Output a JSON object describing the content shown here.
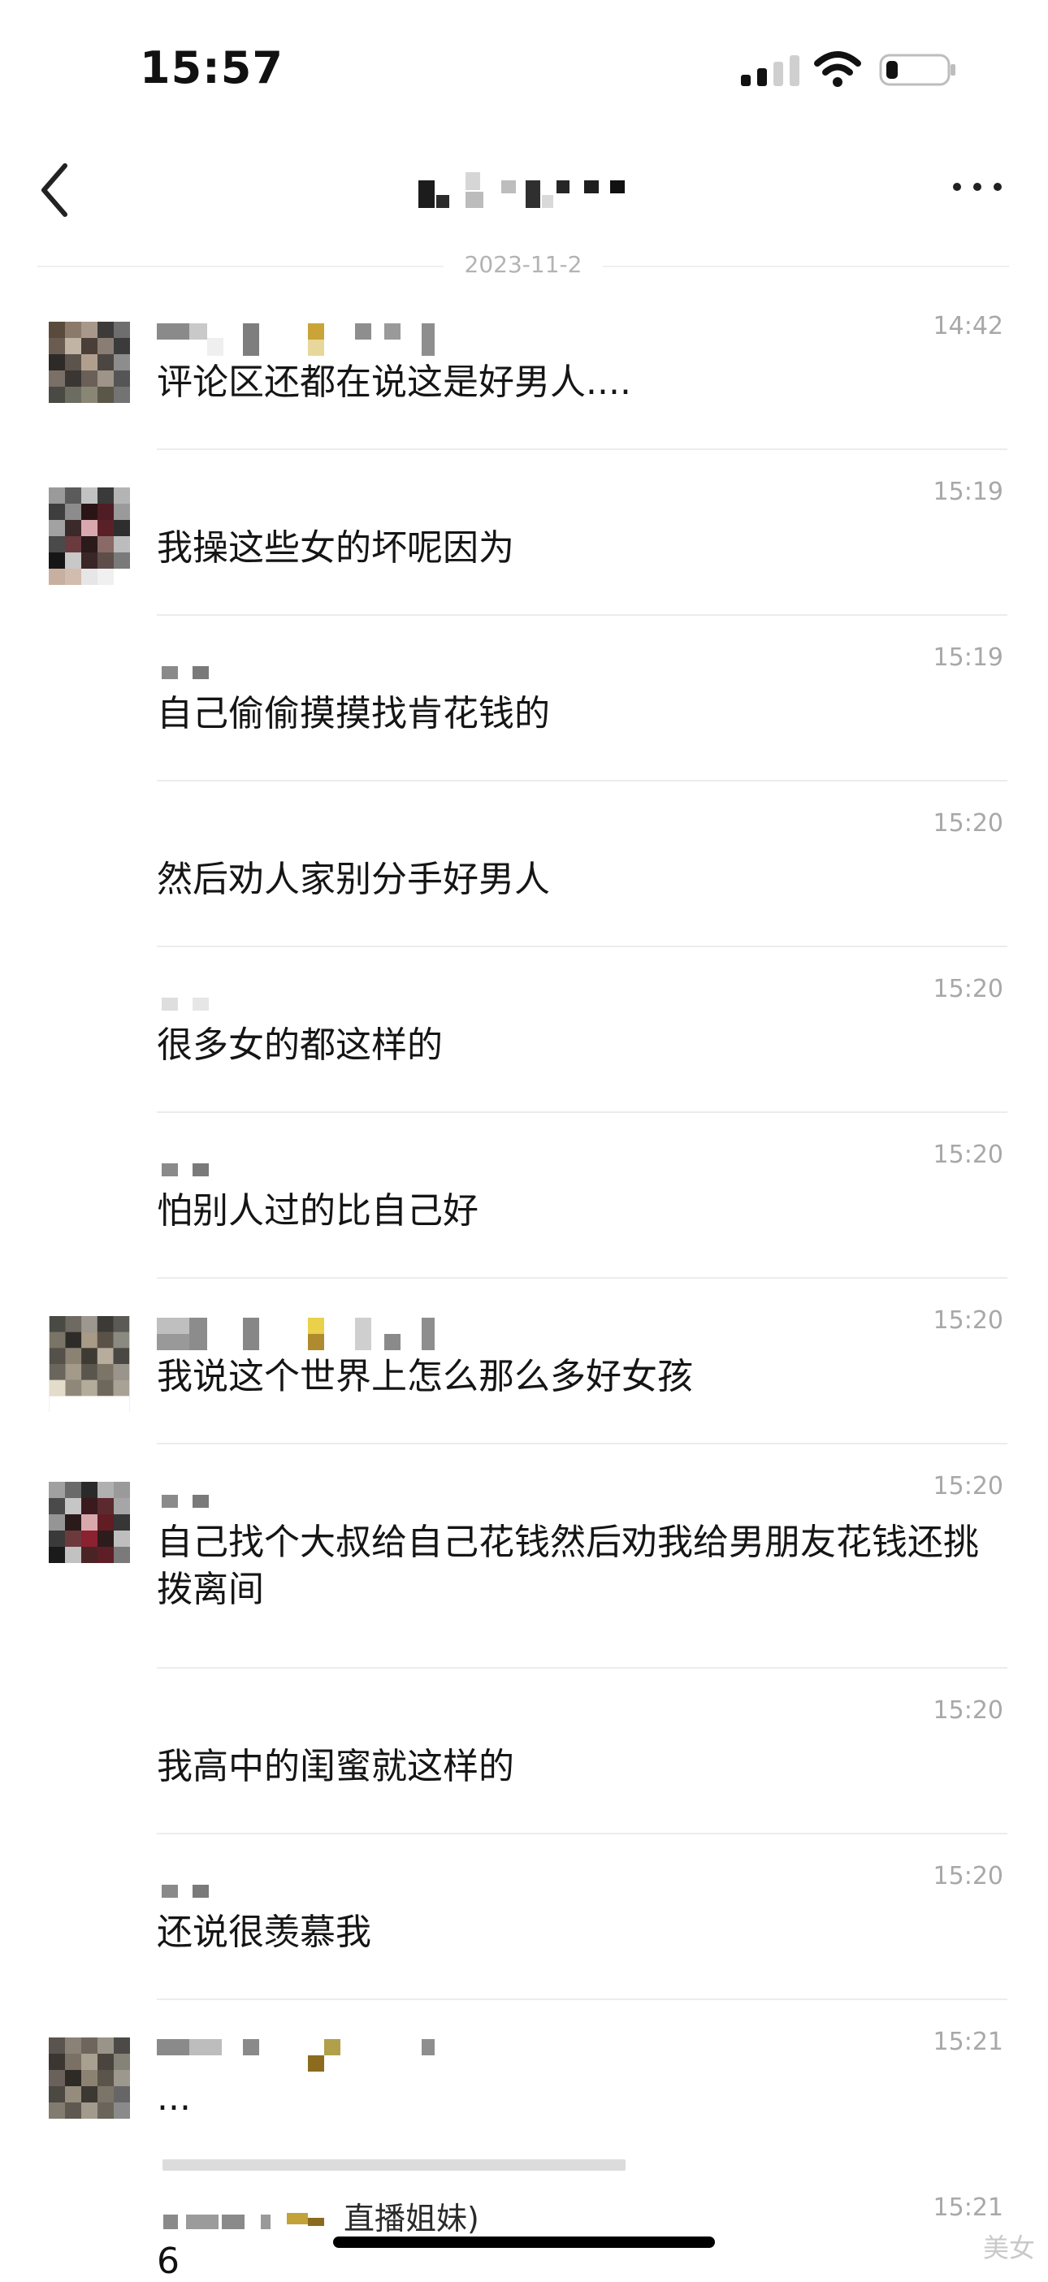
{
  "status_bar": {
    "time": "15:57"
  },
  "header": {
    "back_icon": "chevron-left-icon",
    "more_icon": "ellipsis-icon"
  },
  "date_divider": "2023-11-2",
  "messages": [
    {
      "time": "14:42",
      "text": "评论区还都在说这是好男人....",
      "avatar": true
    },
    {
      "time": "15:19",
      "text": "我操这些女的坏呢因为",
      "avatar": true
    },
    {
      "time": "15:19",
      "text": "自己偷偷摸摸找肯花钱的",
      "avatar": false
    },
    {
      "time": "15:20",
      "text": "然后劝人家别分手好男人",
      "avatar": false
    },
    {
      "time": "15:20",
      "text": "很多女的都这样的",
      "avatar": false
    },
    {
      "time": "15:20",
      "text": "怕别人过的比自己好",
      "avatar": false
    },
    {
      "time": "15:20",
      "text": "我说这个世界上怎么那么多好女孩",
      "avatar": true
    },
    {
      "time": "15:20",
      "text": "自己找个大叔给自己花钱然后劝我给男朋友花钱还挑拨离间",
      "avatar": true
    },
    {
      "time": "15:20",
      "text": "我高中的闺蜜就这样的",
      "avatar": false
    },
    {
      "time": "15:20",
      "text": "还说很羡慕我",
      "avatar": false
    },
    {
      "time": "15:21",
      "text": "...",
      "avatar": true
    }
  ],
  "last_message": {
    "name_suffix": "直播姐妹)",
    "time": "15:21",
    "text": "6"
  },
  "watermark": "美女"
}
